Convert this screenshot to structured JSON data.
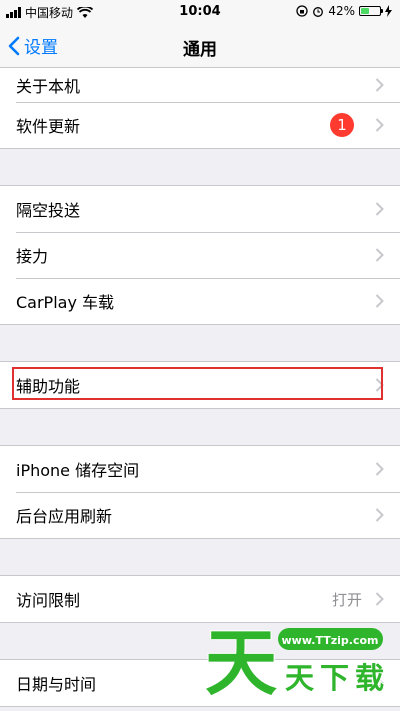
{
  "status": {
    "carrier": "中国移动",
    "time": "10:04",
    "battery": "42%",
    "battery_level": 0.42
  },
  "nav": {
    "back_label": "设置",
    "title": "通用"
  },
  "groups": [
    [
      "关于本机",
      "软件更新"
    ],
    [
      "隔空投送",
      "接力",
      "CarPlay 车载"
    ],
    [
      "辅助功能"
    ],
    [
      "iPhone 储存空间",
      "后台应用刷新"
    ],
    [
      "访问限制"
    ],
    [
      "日期与时间"
    ]
  ],
  "update_badge": "1",
  "restrictions_value": "打开",
  "watermark": {
    "big_char": "天",
    "site": "www.TTzip.com",
    "text": "天下载"
  },
  "colors": {
    "accent": "#007aff",
    "badge": "#ff3b30",
    "highlight": "#e03030",
    "watermark_green": "#2fb52c"
  }
}
